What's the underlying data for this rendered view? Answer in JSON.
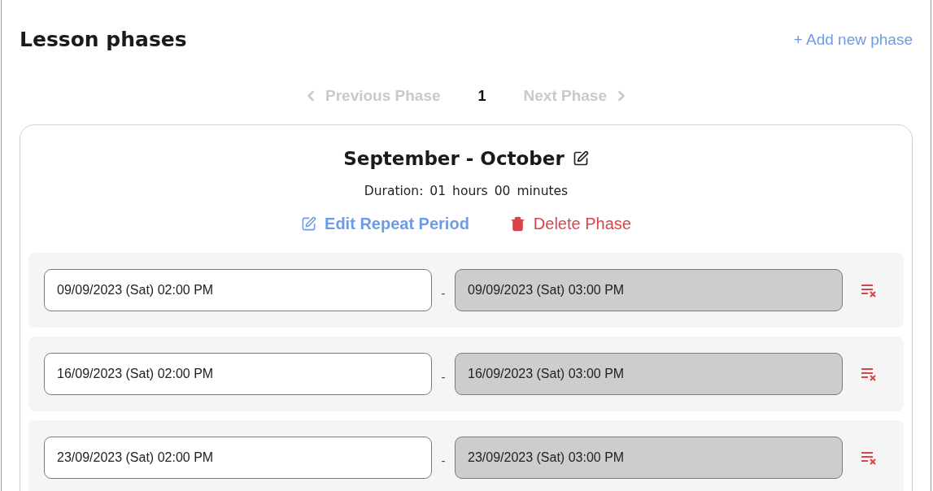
{
  "header": {
    "title": "Lesson phases",
    "add_button": "+ Add new phase"
  },
  "pager": {
    "previous": {
      "label": "Previous Phase",
      "disabled": true
    },
    "page": "1",
    "next": {
      "label": "Next Phase",
      "disabled": true
    }
  },
  "phase": {
    "title": "September - October",
    "duration": {
      "label": "Duration:",
      "hours": "01",
      "hours_unit": "hours",
      "minutes": "00",
      "minutes_unit": "minutes"
    },
    "actions": [
      {
        "kind": "edit",
        "label": "Edit Repeat Period"
      },
      {
        "kind": "delete",
        "label": "Delete Phase"
      }
    ],
    "sessions": [
      {
        "start": {
          "value": "09/09/2023 (Sat) 02:00 PM",
          "disabled": false
        },
        "separator": "-",
        "end": {
          "value": "09/09/2023 (Sat) 03:00 PM",
          "disabled": true
        }
      },
      {
        "start": {
          "value": "16/09/2023 (Sat) 02:00 PM",
          "disabled": false
        },
        "separator": "-",
        "end": {
          "value": "16/09/2023 (Sat) 03:00 PM",
          "disabled": true
        }
      },
      {
        "start": {
          "value": "23/09/2023 (Sat) 02:00 PM",
          "disabled": false
        },
        "separator": "-",
        "end": {
          "value": "23/09/2023 (Sat) 03:00 PM",
          "disabled": true
        }
      }
    ]
  }
}
